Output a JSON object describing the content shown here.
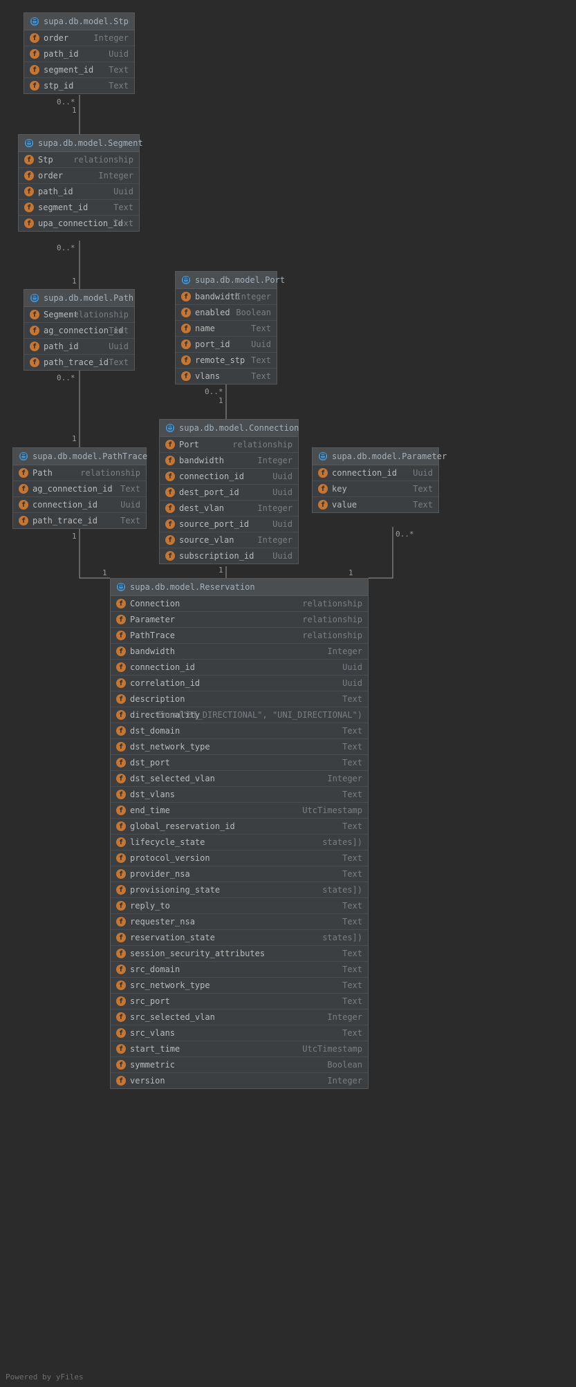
{
  "footer": "Powered by yFiles",
  "entities": {
    "stp": {
      "title": "supa.db.model.Stp",
      "fields": [
        {
          "name": "order",
          "type": "Integer"
        },
        {
          "name": "path_id",
          "type": "Uuid"
        },
        {
          "name": "segment_id",
          "type": "Text"
        },
        {
          "name": "stp_id",
          "type": "Text"
        }
      ]
    },
    "segment": {
      "title": "supa.db.model.Segment",
      "fields": [
        {
          "name": "Stp",
          "type": "relationship"
        },
        {
          "name": "order",
          "type": "Integer"
        },
        {
          "name": "path_id",
          "type": "Uuid"
        },
        {
          "name": "segment_id",
          "type": "Text"
        },
        {
          "name": "upa_connection_id",
          "type": "Text"
        }
      ]
    },
    "path": {
      "title": "supa.db.model.Path",
      "fields": [
        {
          "name": "Segment",
          "type": "relationship"
        },
        {
          "name": "ag_connection_id",
          "type": "Text"
        },
        {
          "name": "path_id",
          "type": "Uuid"
        },
        {
          "name": "path_trace_id",
          "type": "Text"
        }
      ]
    },
    "port": {
      "title": "supa.db.model.Port",
      "fields": [
        {
          "name": "bandwidth",
          "type": "Integer"
        },
        {
          "name": "enabled",
          "type": "Boolean"
        },
        {
          "name": "name",
          "type": "Text"
        },
        {
          "name": "port_id",
          "type": "Uuid"
        },
        {
          "name": "remote_stp",
          "type": "Text"
        },
        {
          "name": "vlans",
          "type": "Text"
        }
      ]
    },
    "pathtrace": {
      "title": "supa.db.model.PathTrace",
      "fields": [
        {
          "name": "Path",
          "type": "relationship"
        },
        {
          "name": "ag_connection_id",
          "type": "Text"
        },
        {
          "name": "connection_id",
          "type": "Uuid"
        },
        {
          "name": "path_trace_id",
          "type": "Text"
        }
      ]
    },
    "connection": {
      "title": "supa.db.model.Connection",
      "fields": [
        {
          "name": "Port",
          "type": "relationship"
        },
        {
          "name": "bandwidth",
          "type": "Integer"
        },
        {
          "name": "connection_id",
          "type": "Uuid"
        },
        {
          "name": "dest_port_id",
          "type": "Uuid"
        },
        {
          "name": "dest_vlan",
          "type": "Integer"
        },
        {
          "name": "source_port_id",
          "type": "Uuid"
        },
        {
          "name": "source_vlan",
          "type": "Integer"
        },
        {
          "name": "subscription_id",
          "type": "Uuid"
        }
      ]
    },
    "parameter": {
      "title": "supa.db.model.Parameter",
      "fields": [
        {
          "name": "connection_id",
          "type": "Uuid"
        },
        {
          "name": "key",
          "type": "Text"
        },
        {
          "name": "value",
          "type": "Text"
        }
      ]
    },
    "reservation": {
      "title": "supa.db.model.Reservation",
      "fields": [
        {
          "name": "Connection",
          "type": "relationship"
        },
        {
          "name": "Parameter",
          "type": "relationship"
        },
        {
          "name": "PathTrace",
          "type": "relationship"
        },
        {
          "name": "bandwidth",
          "type": "Integer"
        },
        {
          "name": "connection_id",
          "type": "Uuid"
        },
        {
          "name": "correlation_id",
          "type": "Uuid"
        },
        {
          "name": "description",
          "type": "Text"
        },
        {
          "name": "directionality",
          "type": "Enum(\"BI_DIRECTIONAL\", \"UNI_DIRECTIONAL\")"
        },
        {
          "name": "dst_domain",
          "type": "Text"
        },
        {
          "name": "dst_network_type",
          "type": "Text"
        },
        {
          "name": "dst_port",
          "type": "Text"
        },
        {
          "name": "dst_selected_vlan",
          "type": "Integer"
        },
        {
          "name": "dst_vlans",
          "type": "Text"
        },
        {
          "name": "end_time",
          "type": "UtcTimestamp"
        },
        {
          "name": "global_reservation_id",
          "type": "Text"
        },
        {
          "name": "lifecycle_state",
          "type": "states])"
        },
        {
          "name": "protocol_version",
          "type": "Text"
        },
        {
          "name": "provider_nsa",
          "type": "Text"
        },
        {
          "name": "provisioning_state",
          "type": "states])"
        },
        {
          "name": "reply_to",
          "type": "Text"
        },
        {
          "name": "requester_nsa",
          "type": "Text"
        },
        {
          "name": "reservation_state",
          "type": "states])"
        },
        {
          "name": "session_security_attributes",
          "type": "Text"
        },
        {
          "name": "src_domain",
          "type": "Text"
        },
        {
          "name": "src_network_type",
          "type": "Text"
        },
        {
          "name": "src_port",
          "type": "Text"
        },
        {
          "name": "src_selected_vlan",
          "type": "Integer"
        },
        {
          "name": "src_vlans",
          "type": "Text"
        },
        {
          "name": "start_time",
          "type": "UtcTimestamp"
        },
        {
          "name": "symmetric",
          "type": "Boolean"
        },
        {
          "name": "version",
          "type": "Integer"
        }
      ]
    }
  },
  "labels": {
    "zero_many": "0..*",
    "one": "1"
  }
}
